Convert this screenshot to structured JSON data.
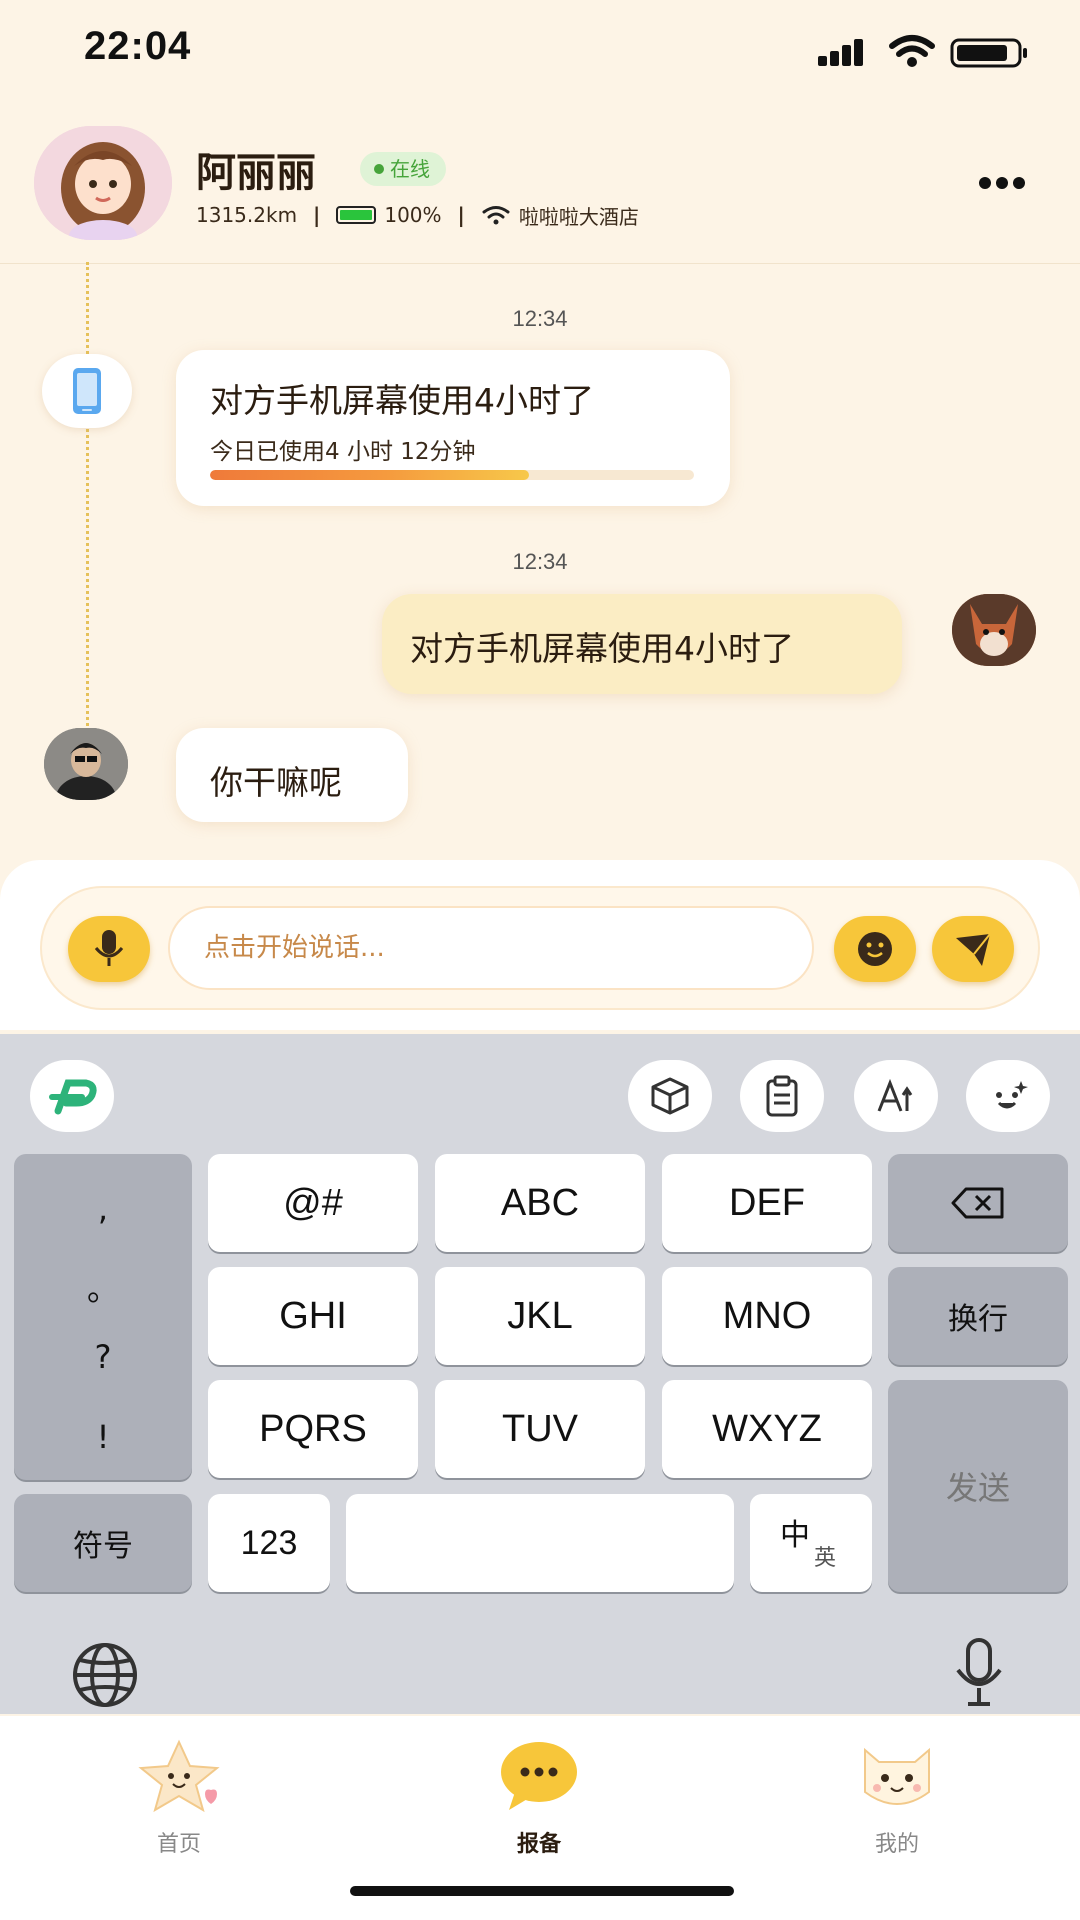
{
  "status_bar": {
    "time": "22:04"
  },
  "header": {
    "name": "阿丽丽",
    "online_label": "在线",
    "distance": "1315.2km",
    "battery": "100%",
    "battery_level": 1.0,
    "wifi_name": "啦啦啦大酒店"
  },
  "messages": [
    {
      "time": "12:34",
      "card_title": "对方手机屏幕使用4小时了",
      "card_sub": "今日已使用4 小时 12分钟",
      "progress": 0.66
    },
    {
      "time": "12:34",
      "text": "对方手机屏幕使用4小时了"
    },
    {
      "text": "你干嘛呢"
    }
  ],
  "input": {
    "placeholder": "点击开始说话..."
  },
  "keyboard": {
    "punct": [
      ",",
      "。",
      "?",
      "!"
    ],
    "row1": [
      "@#",
      "ABC",
      "DEF"
    ],
    "row2": [
      "GHI",
      "JKL",
      "MNO"
    ],
    "row3": [
      "PQRS",
      "TUV",
      "WXYZ"
    ],
    "newline": "换行",
    "send": "发送",
    "symbols": "符号",
    "num": "123",
    "lang_main": "中",
    "lang_sub": "英"
  },
  "tabs": [
    {
      "label": "首页"
    },
    {
      "label": "报备"
    },
    {
      "label": "我的"
    }
  ],
  "colors": {
    "accent": "#f7c63a",
    "background": "#fdf4e6",
    "online": "#46a43a"
  }
}
